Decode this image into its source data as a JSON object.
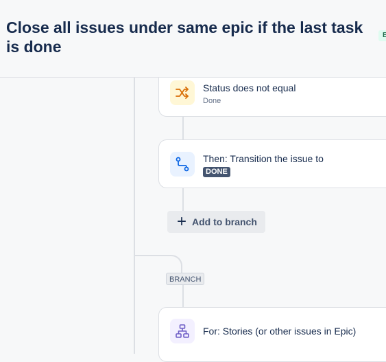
{
  "header": {
    "title": "Close all issues under same epic if the last task is done",
    "status_badge": "EN"
  },
  "flow": {
    "condition": {
      "title": "Status does not equal",
      "subtitle": "Done",
      "icon": "shuffle-icon",
      "icon_color": "#d97008"
    },
    "action": {
      "title": "Then: Transition the issue to",
      "lozenge": "DONE",
      "icon": "transition-icon",
      "icon_color": "#0c66e4"
    },
    "add_branch_label": "Add to branch",
    "branch_tag": "BRANCH",
    "branch": {
      "title": "For: Stories (or other issues in Epic)",
      "icon": "hierarchy-icon",
      "icon_color": "#6e5dc6"
    }
  }
}
